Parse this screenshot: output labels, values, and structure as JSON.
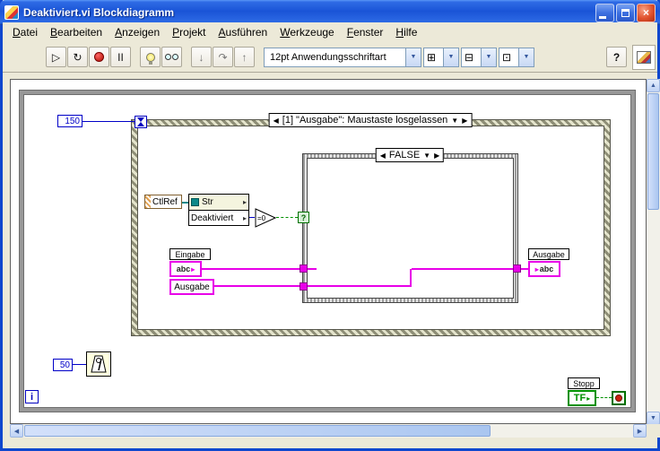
{
  "window": {
    "title": "Deaktiviert.vi Blockdiagramm",
    "close_glyph": "×"
  },
  "menu": {
    "items": [
      {
        "label": "Datei"
      },
      {
        "label": "Bearbeiten"
      },
      {
        "label": "Anzeigen"
      },
      {
        "label": "Projekt"
      },
      {
        "label": "Ausführen"
      },
      {
        "label": "Werkzeuge"
      },
      {
        "label": "Fenster"
      },
      {
        "label": "Hilfe"
      }
    ]
  },
  "toolbar": {
    "run_glyph": "▷",
    "run_continuous_glyph": "↻",
    "pause_glyph": "II",
    "step_into_glyph": "↓",
    "step_over_glyph": "↷",
    "step_out_glyph": "↑",
    "align_glyph": "⊞",
    "distribute_glyph": "⊟",
    "resize_glyph": "⊡",
    "dropdown_arrow": "▼",
    "font_selector": "12pt Anwendungsschriftart",
    "help_glyph": "?"
  },
  "scrollbar": {
    "up": "▲",
    "down": "▼",
    "left": "◀",
    "right": "▶"
  },
  "diagram": {
    "iteration_label": "i",
    "timeout_constant": "150",
    "wait_constant": "50",
    "event_structure": {
      "prev": "◀",
      "label": "[1] \"Ausgabe\": Maustaste losgelassen",
      "menu": "▼",
      "next": "▶"
    },
    "case_structure": {
      "prev": "◀",
      "label": "FALSE",
      "menu": "▼",
      "next": "▶"
    },
    "selector_terminal": "?",
    "ctl_ref": "CtlRef",
    "property_node": {
      "class_name": "Str",
      "property": "Deaktiviert",
      "out_arrow": "▸"
    },
    "equals_zero": "=0",
    "eingabe": {
      "label": "Eingabe",
      "value": "abc",
      "arrow": "▸"
    },
    "ausgabe_local": "Ausgabe",
    "ausgabe": {
      "label": "Ausgabe",
      "value": "abc",
      "arrow": "▸"
    },
    "stopp": {
      "label": "Stopp",
      "value": "TF",
      "arrow": "▸"
    }
  },
  "colors": {
    "string_pink": "#E800E8",
    "numeric_blue": "#0000C8",
    "boolean_green": "#009000",
    "refnum_teal": "#0E8A8A",
    "titlebar_blue": "#1A54D7"
  }
}
